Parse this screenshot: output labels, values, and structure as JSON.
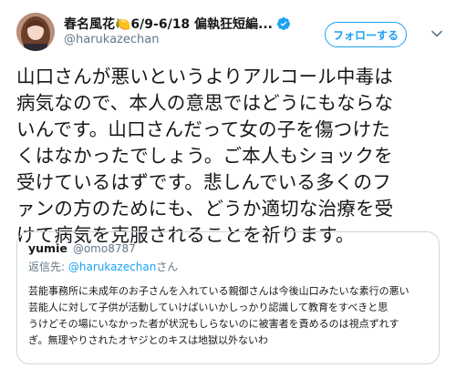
{
  "author": {
    "display_name": "春名風花🍋6/9-6/18 偏執狂短編...",
    "handle": "@harukazechan",
    "follow_label": "フォローする"
  },
  "tweet": {
    "lines": [
      "山口さんが悪いというよりアルコール中毒は",
      "病気なので、本人の意思ではどうにもならな",
      "いんです。山口さんだって女の子を傷つけた",
      "くはなかったでしょう。ご本人もショックを",
      "受けているはずです。悲しんでいる多くのフ",
      "ァンの方のためにも、どうか適切な治療を受",
      "けて病気を克服されることを祈ります。"
    ]
  },
  "quote": {
    "name": "yumie",
    "handle": "@omo8787",
    "reply_prefix": "返信先: ",
    "reply_mention": "@harukazechan",
    "reply_suffix": "さん",
    "lines": [
      "芸能事務所に未成年のお子さんを入れている親御さんは今後山口みたいな素行の悪い",
      "芸能人に対して子供が活動していけばいいかしっかり認識して教育をすべきと思",
      "うけどその場にいなかった者が状況もしらないのに被害者を責めるのは視点ずれす",
      "ぎ。無理やりされたオヤジとのキスは地獄以外ないわ"
    ]
  },
  "colors": {
    "accent": "#1da1f2",
    "secondary_text": "#657786",
    "border": "#ccd6dd"
  }
}
